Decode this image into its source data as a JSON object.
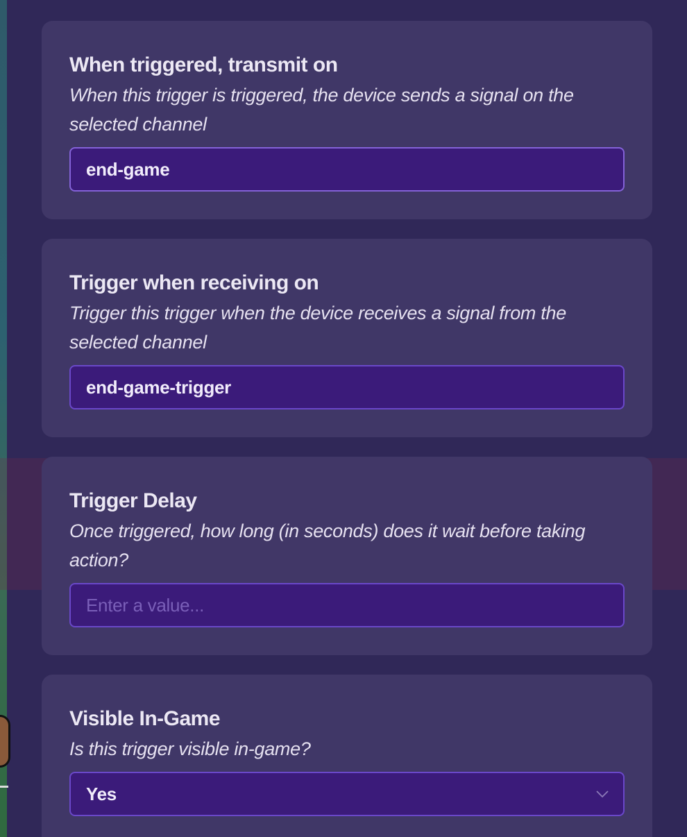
{
  "panels": [
    {
      "title": "When triggered, transmit on",
      "description": "When this trigger is triggered, the device sends a signal on the selected channel",
      "value": "end-game"
    },
    {
      "title": "Trigger when receiving on",
      "description": "Trigger this trigger when the device receives a signal from the selected channel",
      "value": "end-game-trigger"
    },
    {
      "title": "Trigger Delay",
      "description": "Once triggered, how long (in seconds) does it wait before taking action?",
      "placeholder": "Enter a value..."
    },
    {
      "title": "Visible In-Game",
      "description": "Is this trigger visible in-game?",
      "selected": "Yes",
      "icon": "chevron-down-icon"
    }
  ]
}
